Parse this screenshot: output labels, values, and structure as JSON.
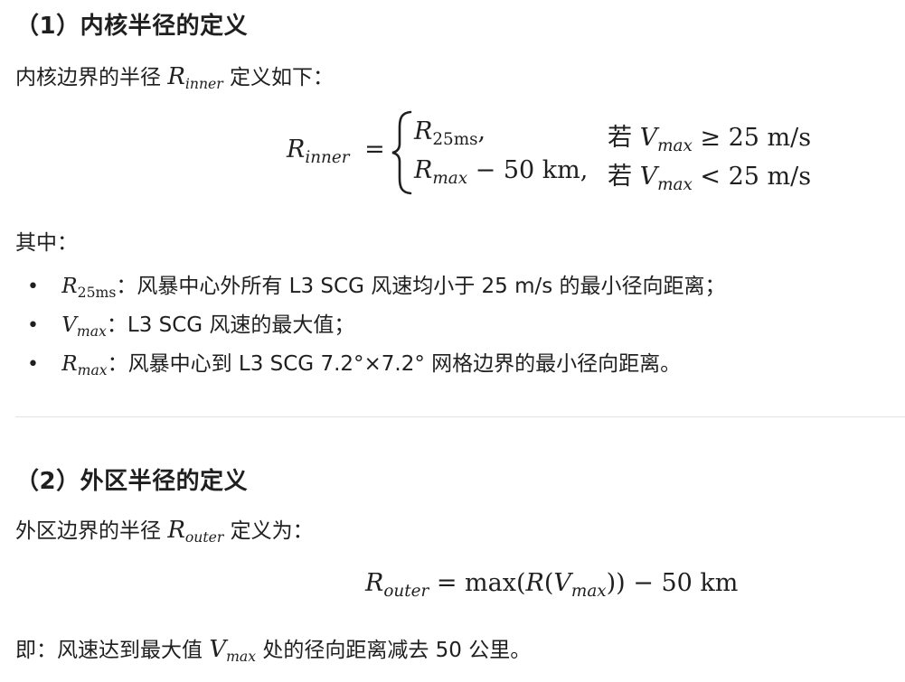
{
  "section1": {
    "heading": "（1）内核半径的定义",
    "intro_prefix": "内核边界的半径",
    "intro_suffix": "定义如下：",
    "R": "R",
    "inner": "inner",
    "equals": "=",
    "case1_var": "R",
    "case1_sub": "25ms",
    "case1_tail": ",",
    "case2_var": "R",
    "case2_sub": "max",
    "case2_tail": "− 50 km,",
    "cond_word": "若",
    "V": "V",
    "max": "max",
    "cond1_rel": "≥ 25 m/s",
    "cond2_rel": "< 25 m/s",
    "where": "其中：",
    "bullets": [
      {
        "var": "R",
        "sub": "25ms",
        "text": "：风暴中心外所有 L3 SCG 风速均小于 25 m/s 的最小径向距离；"
      },
      {
        "var": "V",
        "sub": "max",
        "text": "：L3 SCG 风速的最大值；"
      },
      {
        "var": "R",
        "sub": "max",
        "text": "：风暴中心到 L3 SCG 7.2°×7.2° 网格边界的最小径向距离。"
      }
    ]
  },
  "section2": {
    "heading": "（2）外区半径的定义",
    "intro_prefix": "外区边界的半径",
    "intro_suffix": "定义为：",
    "R": "R",
    "outer": "outer",
    "eq_mid": "= max(",
    "eq_R": "R",
    "eq_paren": "(",
    "eq_V": "V",
    "eq_max": "max",
    "eq_tail": ")) − 50 km",
    "conclusion_prefix": "即：风速达到最大值",
    "conclusion_suffix": "处的径向距离减去 50 公里。"
  }
}
